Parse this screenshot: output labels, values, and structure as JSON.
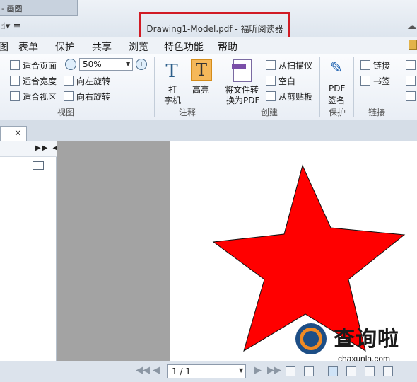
{
  "titlebar": {
    "paint_tab": "- 画图",
    "quick_access": "☝▾ ≡",
    "title": "Drawing1-Model.pdf - 福昕阅读器"
  },
  "menu": {
    "items": [
      "图",
      "表单",
      "保护",
      "共享",
      "浏览",
      "特色功能",
      "帮助"
    ]
  },
  "ribbon": {
    "view": {
      "fit_page": "适合页面",
      "fit_width": "适合宽度",
      "fit_region": "适合视区",
      "zoom_value": "50%",
      "rotate_left": "向左旋转",
      "rotate_right": "向右旋转",
      "group_label": "视图"
    },
    "comment": {
      "typewriter_line1": "打",
      "typewriter_line2": "字机",
      "highlight": "高亮",
      "group_label": "注释"
    },
    "create": {
      "convert_line1": "将文件转",
      "convert_line2": "换为PDF",
      "from_scanner": "从扫描仪",
      "blank": "空白",
      "from_clipboard": "从剪贴板",
      "group_label": "创建"
    },
    "protect": {
      "pdf_sign_line1": "PDF",
      "pdf_sign_line2": "签名",
      "group_label": "保护"
    },
    "link": {
      "link": "链接",
      "bookmark": "书签",
      "group_label": "链接"
    }
  },
  "tabs": {
    "close_glyph": "×"
  },
  "panel": {
    "arrows": "▶▶ ◀"
  },
  "document": {
    "star_color": "#ff0000"
  },
  "status": {
    "page_field": "1 / 1"
  },
  "watermark": {
    "title": "查询啦",
    "url": "chaxunla.com"
  },
  "colors": {
    "title_highlight": "#d11b24",
    "gray_area": "#a3a3a3",
    "watermark_blue": "#1d4e86",
    "watermark_orange": "#f08a24"
  }
}
